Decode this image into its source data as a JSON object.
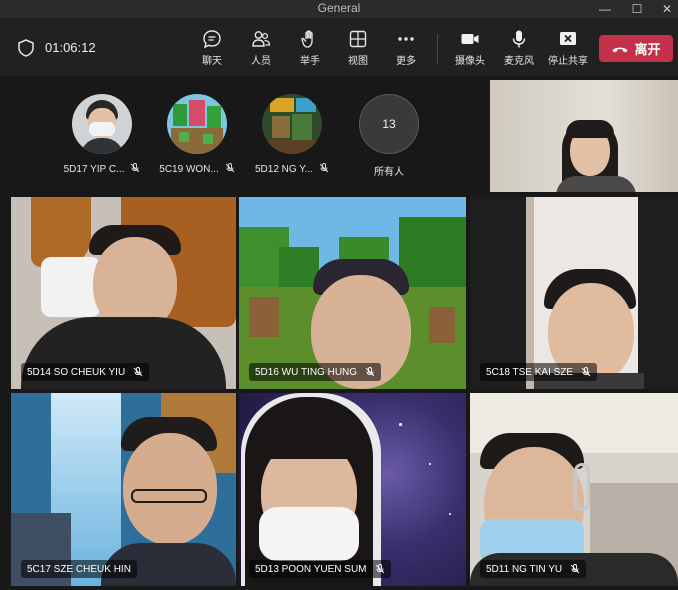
{
  "window": {
    "title": "General",
    "minimize": "—",
    "maximize": "☐",
    "close": "✕"
  },
  "meeting": {
    "timer": "01:06:12"
  },
  "toolbar": {
    "chat": "聊天",
    "people": "人员",
    "raise_hand": "举手",
    "view": "视图",
    "more": "更多",
    "camera": "摄像头",
    "mic": "麦克风",
    "stop_share": "停止共享",
    "leave": "离开"
  },
  "colors": {
    "leave_red": "#c4314b",
    "background": "#1b1b1b",
    "toolbar": "#212121"
  },
  "avatars": [
    {
      "name": "5D17 YIP C..."
    },
    {
      "name": "5C19 WON..."
    },
    {
      "name": "5D12 NG Y..."
    }
  ],
  "all_people": {
    "count": "13",
    "label": "所有人"
  },
  "tiles": [
    {
      "name": "5D14 SO CHEUK YIU"
    },
    {
      "name": "5D16 WU TING HUNG"
    },
    {
      "name": "5C18 TSE KAI SZE"
    },
    {
      "name": "5C17 SZE CHEUK HIN"
    },
    {
      "name": "5D13 POON YUEN SUM"
    },
    {
      "name": "5D11 NG TIN YU"
    }
  ]
}
